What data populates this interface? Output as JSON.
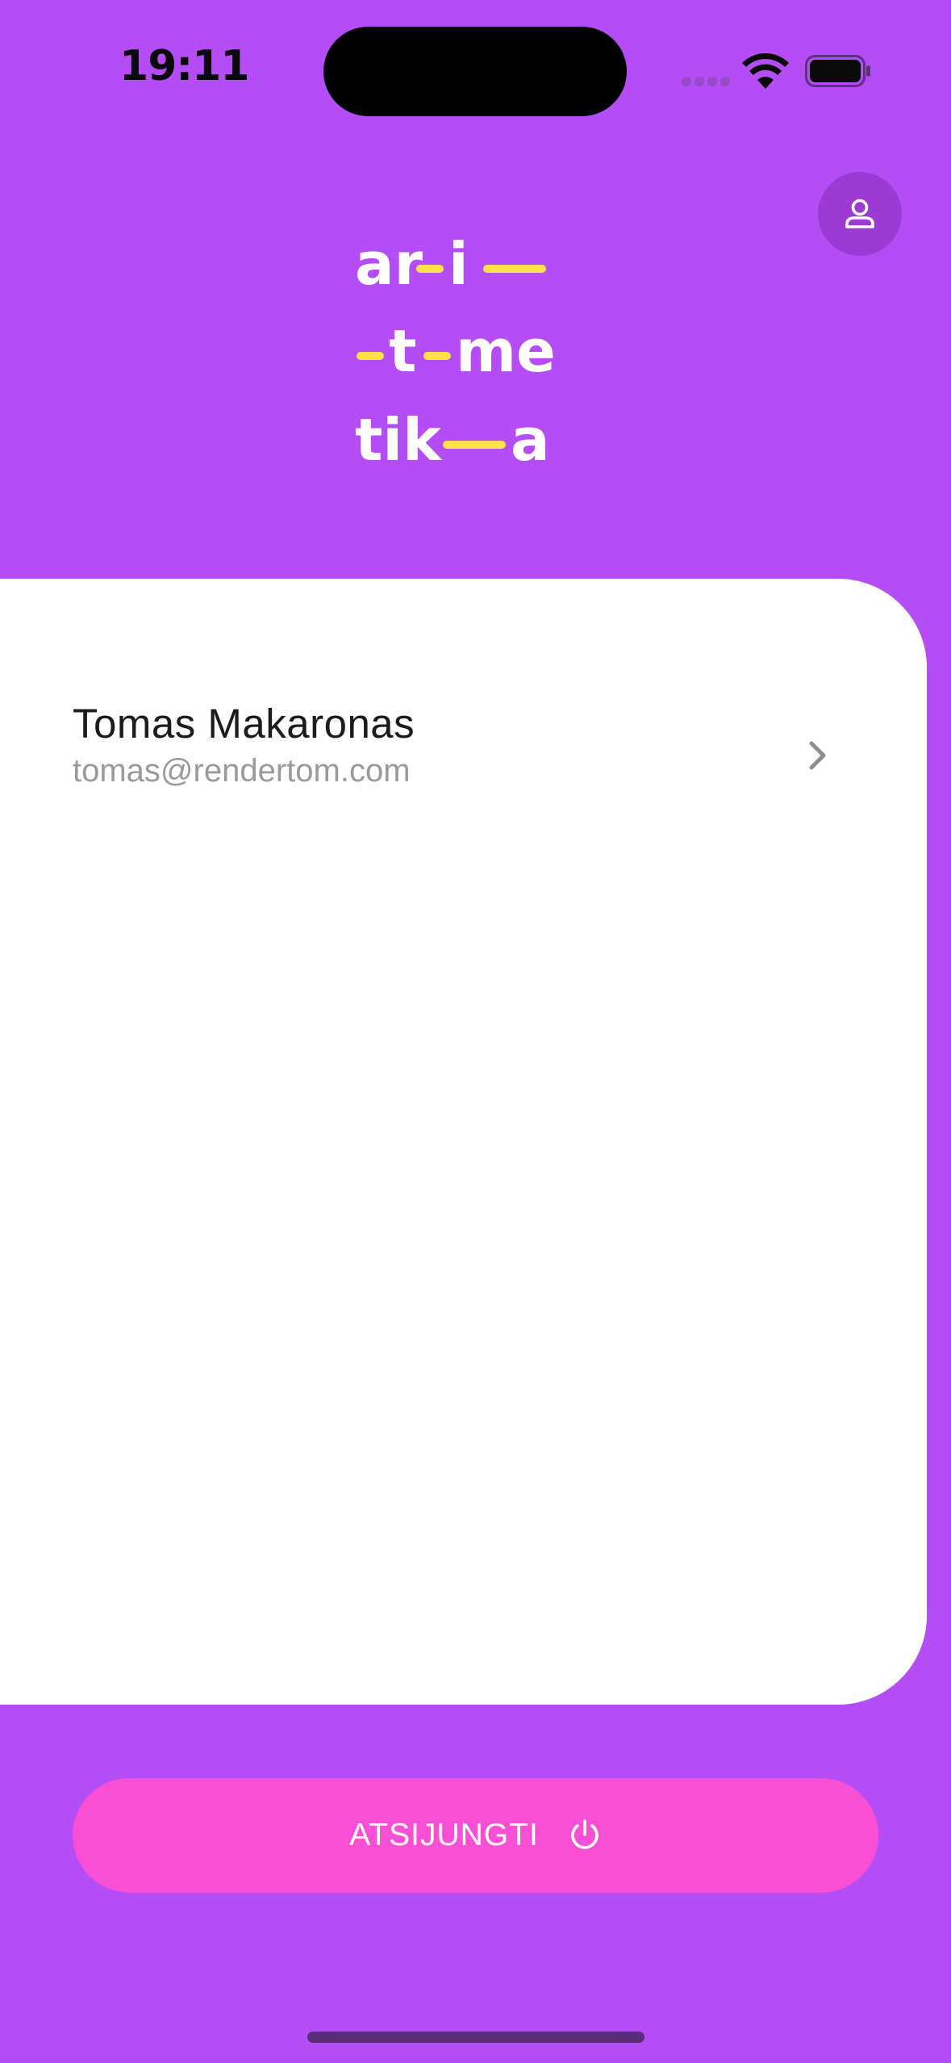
{
  "status_bar": {
    "time": "19:11"
  },
  "logo": {
    "text": "ar-i--\n-t-me\ntik--a",
    "lines": [
      [
        {
          "t": "ar"
        },
        {
          "dash": 1
        },
        {
          "t": "i"
        },
        {
          "dash": 2
        }
      ],
      [
        {
          "dash": 1
        },
        {
          "t": "t"
        },
        {
          "dash": 1
        },
        {
          "t": "me"
        }
      ],
      [
        {
          "t": "tik"
        },
        {
          "dash": 2
        },
        {
          "t": "a"
        }
      ]
    ],
    "text_color": "#FFFFFF",
    "dash_color": "#FFE24A"
  },
  "profile_button": {
    "icon": "person-icon"
  },
  "user": {
    "name": "Tomas Makaronas",
    "email": "tomas@rendertom.com"
  },
  "logout_button": {
    "label": "ATSIJUNGTI",
    "icon": "power-icon"
  },
  "colors": {
    "background": "#B54DF6",
    "accent_button": "#F94FD5",
    "profile_button": "#9B3BD3",
    "card": "#FFFFFF"
  }
}
